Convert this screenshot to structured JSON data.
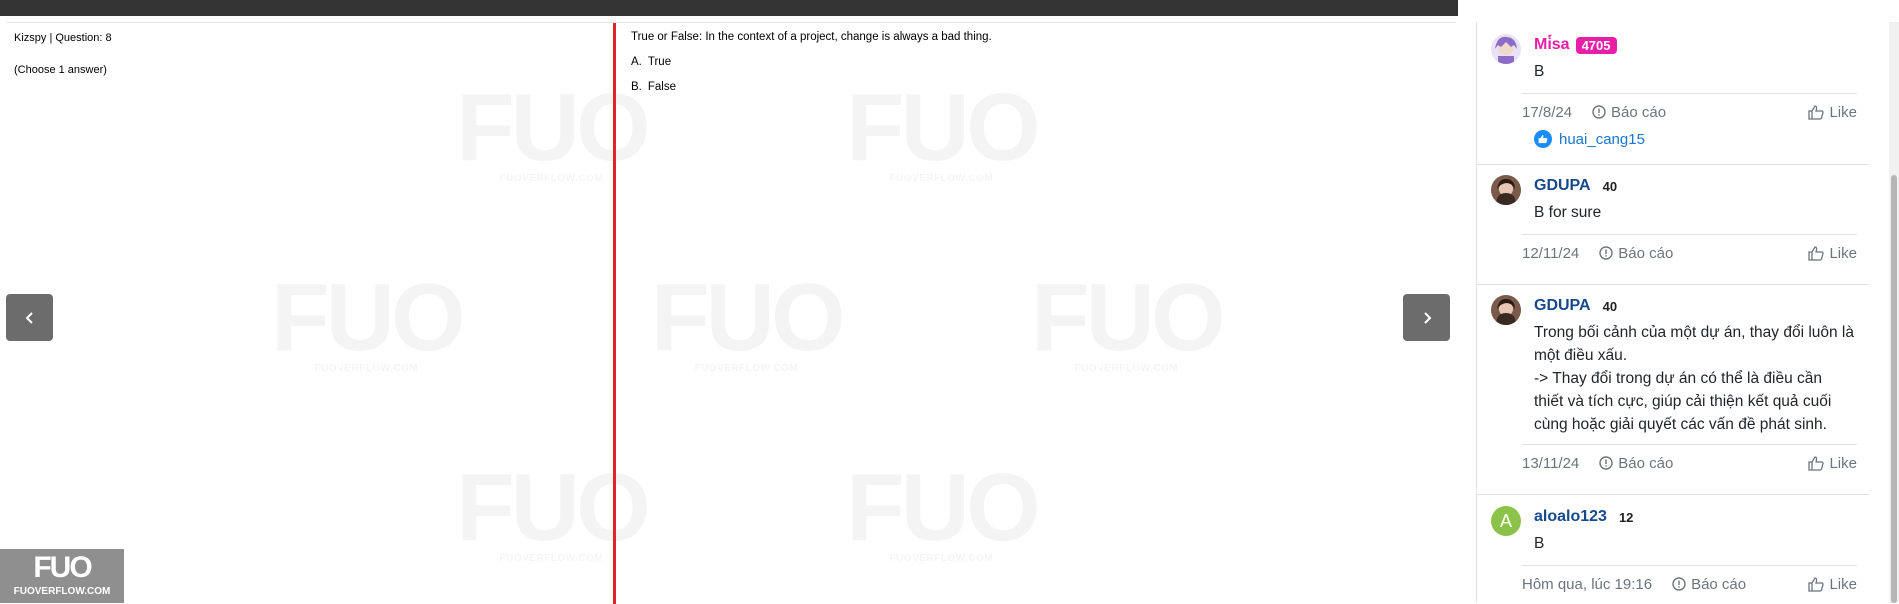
{
  "quiz": {
    "meta": "Kizspy | Question: 8",
    "hint": "(Choose 1 answer)",
    "question": "True or False: In the context of a project, change is always a bad thing.",
    "options": [
      {
        "letter": "A.",
        "text": "True"
      },
      {
        "letter": "B.",
        "text": "False"
      }
    ],
    "watermark": {
      "big": "FUO",
      "small": "FUOVERFLOW.COM"
    },
    "logo": {
      "big": "FUO",
      "small": "FUOVERFLOW.COM"
    }
  },
  "comments": [
    {
      "author": "Mi̇́sa",
      "badge": "4705",
      "body": "B",
      "date": "17/8/24",
      "report": "Báo cáo",
      "like": "Like",
      "liker": "huai_cang15"
    },
    {
      "author": "GDUPA",
      "score": "40",
      "body": "B for sure",
      "date": "12/11/24",
      "report": "Báo cáo",
      "like": "Like"
    },
    {
      "author": "GDUPA",
      "score": "40",
      "body": "Trong bối cảnh của một dự án, thay đổi luôn là một điều xấu.\n-> Thay đổi trong dự án có thể là điều cần thiết và tích cực, giúp cải thiện kết quả cuối cùng hoặc giải quyết các vấn đề phát sinh.",
      "date": "13/11/24",
      "report": "Báo cáo",
      "like": "Like"
    },
    {
      "author": "aloalo123",
      "score": "12",
      "avatar_letter": "A",
      "body": "B",
      "date": "Hôm qua, lúc 19:16",
      "report": "Báo cáo",
      "like": "Like"
    }
  ],
  "colors": {
    "divider": "#e0242a",
    "author": "#174a8c",
    "highlight": "#e91ea7",
    "nav_button": "#6c6c6c"
  }
}
